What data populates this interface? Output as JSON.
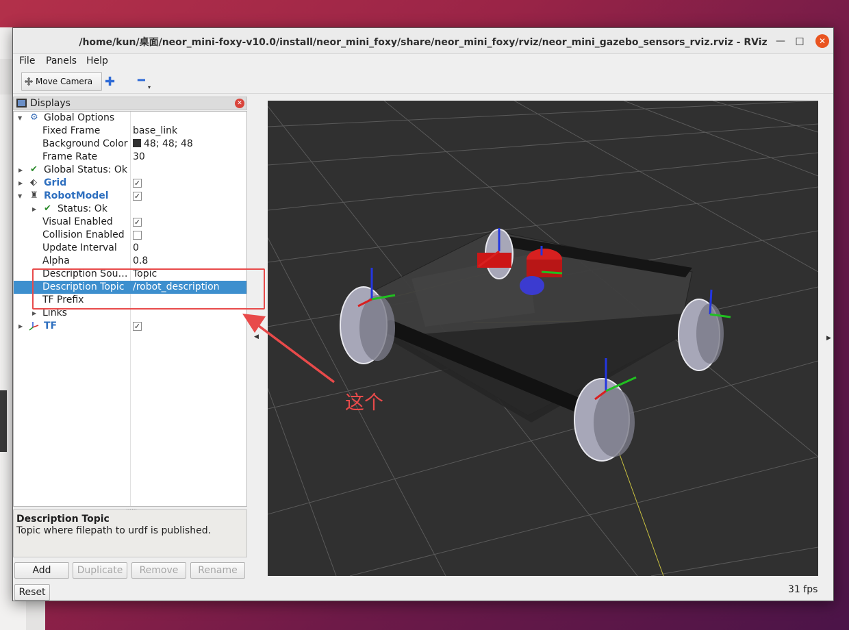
{
  "window": {
    "title": "/home/kun/桌面/neor_mini-foxy-v10.0/install/neor_mini_foxy/share/neor_mini_foxy/rviz/neor_mini_gazebo_sensors_rviz.rviz - RViz",
    "minimize_glyph": "—",
    "maximize_glyph": "□",
    "close_glyph": "✕"
  },
  "menu": [
    {
      "label": "File"
    },
    {
      "label": "Panels"
    },
    {
      "label": "Help"
    }
  ],
  "toolbar": {
    "move_camera_label": "Move Camera",
    "add_tool_glyph": "✚",
    "remove_tool_glyph": "━"
  },
  "displays": {
    "header": "Displays",
    "rows": [
      {
        "label": "Global Options",
        "value": ""
      },
      {
        "label": "Fixed Frame",
        "value": "base_link"
      },
      {
        "label": "Background Color",
        "value": "48; 48; 48"
      },
      {
        "label": "Frame Rate",
        "value": "30"
      },
      {
        "label": "Global Status: Ok",
        "value": ""
      },
      {
        "label": "Grid",
        "checked": "✓"
      },
      {
        "label": "RobotModel",
        "checked": "✓"
      },
      {
        "label": "Status: Ok",
        "value": ""
      },
      {
        "label": "Visual Enabled",
        "checked": "✓"
      },
      {
        "label": "Collision Enabled",
        "checked": ""
      },
      {
        "label": "Update Interval",
        "value": "0"
      },
      {
        "label": "Alpha",
        "value": "0.8"
      },
      {
        "label": "Description Sou…",
        "value": "Topic"
      },
      {
        "label": "Description Topic",
        "value": "/robot_description"
      },
      {
        "label": "TF Prefix",
        "value": ""
      },
      {
        "label": "Links",
        "value": ""
      },
      {
        "label": "TF",
        "checked": "✓"
      }
    ]
  },
  "help": {
    "title": "Description Topic",
    "text": "Topic where filepath to urdf is published."
  },
  "buttons": {
    "add": "Add",
    "duplicate": "Duplicate",
    "remove": "Remove",
    "rename": "Rename",
    "reset": "Reset"
  },
  "status": {
    "fps": "31 fps"
  },
  "annotation": {
    "text": "这个",
    "color": "#e84a4a"
  },
  "colors": {
    "selection": "#3d8fce",
    "view_background": "#303030",
    "accent_link": "#2e6fbf"
  }
}
